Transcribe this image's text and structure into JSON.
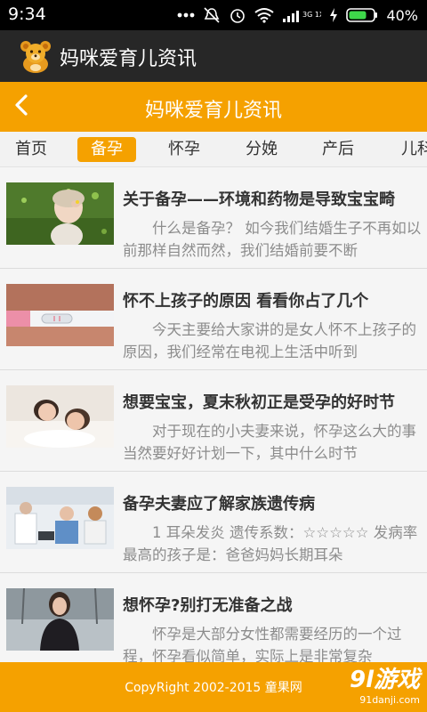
{
  "status_bar": {
    "time": "9:34",
    "network_label": "3G 1X",
    "battery": "40%"
  },
  "app_bar": {
    "title": "妈咪爱育儿资讯",
    "logo_icon": "teddy-bear-icon"
  },
  "page_header": {
    "title": "妈咪爱育儿资讯",
    "back_icon": "chevron-left-icon"
  },
  "tabs": [
    {
      "label": "首页",
      "active": false
    },
    {
      "label": "备孕",
      "active": true
    },
    {
      "label": "怀孕",
      "active": false
    },
    {
      "label": "分娩",
      "active": false
    },
    {
      "label": "产后",
      "active": false
    },
    {
      "label": "儿科",
      "active": false
    }
  ],
  "articles": [
    {
      "title": "关于备孕——环境和药物是导致宝宝畸",
      "summary": "什么是备孕？ 如今我们结婚生子不再如以前那样自然而然，我们结婚前要不断"
    },
    {
      "title": "怀不上孩子的原因 看看你占了几个",
      "summary": "今天主要给大家讲的是女人怀不上孩子的原因，我们经常在电视上生活中听到"
    },
    {
      "title": "想要宝宝，夏末秋初正是受孕的好时节",
      "summary": "对于现在的小夫妻来说，怀孕这么大的事当然要好好计划一下，其中什么时节"
    },
    {
      "title": "备孕夫妻应了解家族遗传病",
      "summary": "1 耳朵发炎 遗传系数：☆☆☆☆☆ 发病率最高的孩子是：爸爸妈妈长期耳朵"
    },
    {
      "title": "想怀孕?别打无准备之战",
      "summary": "怀孕是大部分女性都需要经历的一个过程，怀孕看似简单，实际上是非常复杂"
    }
  ],
  "footer": {
    "copyright": "CopyRight 2002-2015 童果网",
    "watermark_main": "9l游戏",
    "watermark_sub": "91danji.com"
  },
  "colors": {
    "accent": "#f5a100",
    "app_bar": "#272727",
    "status_bar": "#000000"
  }
}
